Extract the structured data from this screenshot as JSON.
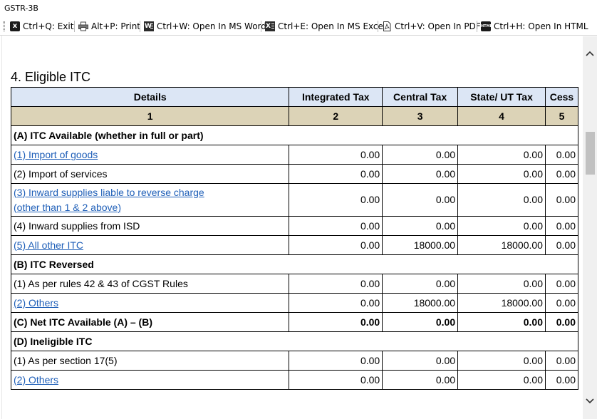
{
  "window": {
    "title": "GSTR-3B"
  },
  "toolbar": {
    "exit": "Ctrl+Q: Exit",
    "print": "Alt+P: Print",
    "word": "Ctrl+W: Open In MS Word",
    "excel": "Ctrl+E: Open In MS Excel",
    "pdf": "Ctrl+V: Open In PDF",
    "html": "Ctrl+H: Open In HTML",
    "icon_exit_glyph": "x",
    "icon_word_glyph": "W",
    "icon_excel_glyph": "X",
    "icon_html_glyph": "HTML"
  },
  "section": {
    "heading": "4. Eligible ITC"
  },
  "table": {
    "headers": [
      "Details",
      "Integrated Tax",
      "Central Tax",
      "State/ UT Tax",
      "Cess"
    ],
    "column_numbers": [
      "1",
      "2",
      "3",
      "4",
      "5"
    ],
    "rows": [
      {
        "label": "(A) ITC Available (whether in full or part)"
      },
      {
        "label": "(1) Import of goods",
        "values": [
          "0.00",
          "0.00",
          "0.00",
          "0.00"
        ]
      },
      {
        "label": "(2) Import of services",
        "values": [
          "0.00",
          "0.00",
          "0.00",
          "0.00"
        ]
      },
      {
        "label": "(3) Inward supplies liable to reverse charge",
        "label2": "(other than 1 & 2 above)",
        "values": [
          "0.00",
          "0.00",
          "0.00",
          "0.00"
        ]
      },
      {
        "label": "(4) Inward supplies from ISD",
        "values": [
          "0.00",
          "0.00",
          "0.00",
          "0.00"
        ]
      },
      {
        "label": "(5) All other ITC",
        "values": [
          "0.00",
          "18000.00",
          "18000.00",
          "0.00"
        ]
      },
      {
        "label": "(B) ITC Reversed"
      },
      {
        "label": "(1) As per rules 42 & 43 of CGST Rules",
        "values": [
          "0.00",
          "0.00",
          "0.00",
          "0.00"
        ]
      },
      {
        "label": "(2) Others",
        "values": [
          "0.00",
          "18000.00",
          "18000.00",
          "0.00"
        ]
      },
      {
        "label": "(C) Net ITC Available (A) – (B)",
        "values": [
          "0.00",
          "0.00",
          "0.00",
          "0.00"
        ]
      },
      {
        "label": "(D) Ineligible ITC"
      },
      {
        "label": "(1) As per section 17(5)",
        "values": [
          "0.00",
          "0.00",
          "0.00",
          "0.00"
        ]
      },
      {
        "label": "(2) Others",
        "values": [
          "0.00",
          "0.00",
          "0.00",
          "0.00"
        ]
      }
    ]
  },
  "colors": {
    "header_bg": "#dce6f5",
    "colnum_bg": "#dcd3b7",
    "link": "#1f5fb8"
  }
}
